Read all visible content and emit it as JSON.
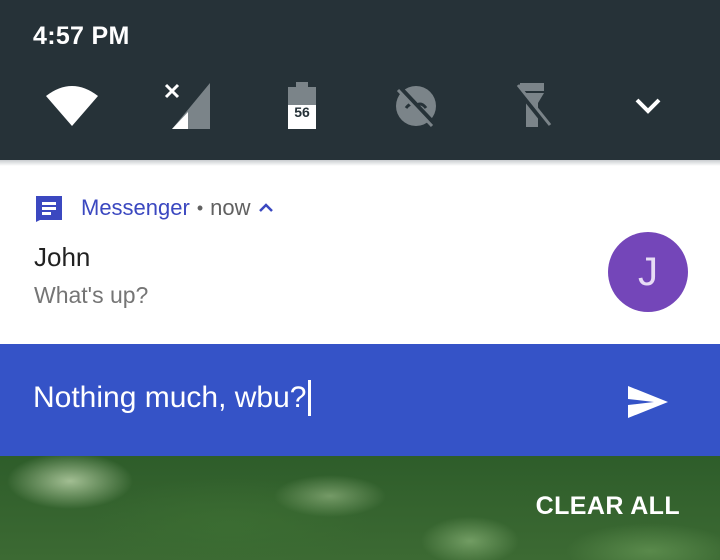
{
  "status": {
    "time": "4:57 PM"
  },
  "quick_settings": {
    "tiles": [
      {
        "name": "wifi-icon"
      },
      {
        "name": "cellular-signal-icon"
      },
      {
        "name": "battery-icon",
        "label": "56"
      },
      {
        "name": "data-saver-icon"
      },
      {
        "name": "flashlight-off-icon"
      },
      {
        "name": "expand-chevron-icon"
      }
    ]
  },
  "notification": {
    "app_name": "Messenger",
    "separator": "•",
    "time": "now",
    "sender": "John",
    "message": "What's up?",
    "avatar_initial": "J",
    "avatar_color": "#7446b9",
    "accent_color": "#3b48c0"
  },
  "reply": {
    "text": "Nothing much, wbu?",
    "bar_color": "#3553c7"
  },
  "actions": {
    "clear_all": "CLEAR ALL"
  }
}
